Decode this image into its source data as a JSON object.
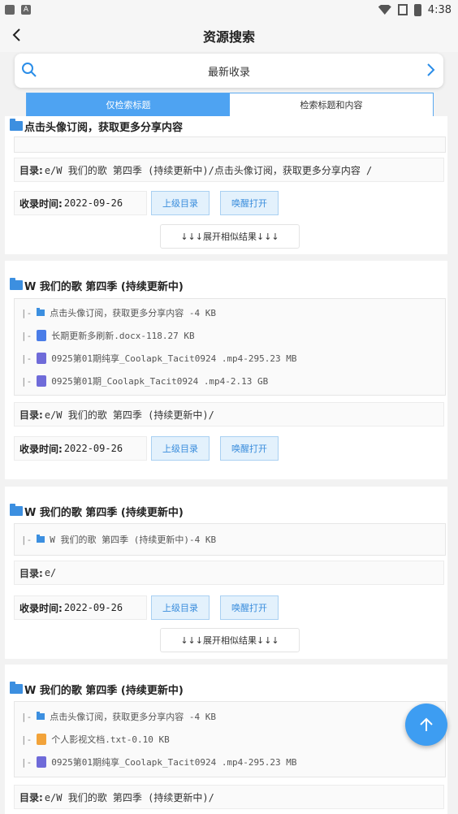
{
  "status_bar": {
    "time": "4:38",
    "left_icons": [
      "A"
    ]
  },
  "app_bar": {
    "title": "资源搜索"
  },
  "search": {
    "label": "最新收录"
  },
  "tabs": [
    {
      "label": "仅检索标题",
      "active": true
    },
    {
      "label": "检索标题和内容",
      "active": false
    }
  ],
  "results": [
    {
      "title": "点击头像订阅，获取更多分享内容",
      "files": [],
      "dir_key": "目录:",
      "dir_value": "e/W 我们的歌 第四季 (持续更新中)/点击头像订阅，获取更多分享内容 /",
      "time_key": "收录时间:",
      "time_value": "2022-09-26",
      "btn_parent": "上级目录",
      "btn_open": "唤醒打开",
      "expand": "↓↓↓展开相似结果↓↓↓"
    },
    {
      "title": "W 我们的歌 第四季 (持续更新中)",
      "files": [
        {
          "icon": "folder",
          "text": "点击头像订阅，获取更多分享内容 -4 KB"
        },
        {
          "icon": "doc",
          "text": "长期更新多刷新.docx-118.27 KB"
        },
        {
          "icon": "mp4",
          "text": "0925第01期纯享_Coolapk_Tacit0924 .mp4-295.23 MB"
        },
        {
          "icon": "mp4",
          "text": "0925第01期_Coolapk_Tacit0924 .mp4-2.13 GB"
        }
      ],
      "dir_key": "目录:",
      "dir_value": "e/W 我们的歌 第四季 (持续更新中)/",
      "time_key": "收录时间:",
      "time_value": "2022-09-26",
      "btn_parent": "上级目录",
      "btn_open": "唤醒打开"
    },
    {
      "title": "W 我们的歌 第四季 (持续更新中)",
      "files": [
        {
          "icon": "folder",
          "text": "W 我们的歌 第四季 (持续更新中)-4 KB"
        }
      ],
      "dir_key": "目录:",
      "dir_value": "e/",
      "time_key": "收录时间:",
      "time_value": "2022-09-26",
      "btn_parent": "上级目录",
      "btn_open": "唤醒打开",
      "expand": "↓↓↓展开相似结果↓↓↓"
    },
    {
      "title": "W 我们的歌 第四季 (持续更新中)",
      "files": [
        {
          "icon": "folder",
          "text": "点击头像订阅，获取更多分享内容 -4 KB"
        },
        {
          "icon": "txt",
          "text": "个人影视文档.txt-0.10 KB"
        },
        {
          "icon": "mp4",
          "text": "0925第01期纯享_Coolapk_Tacit0924 .mp4-295.23 MB"
        }
      ],
      "dir_key": "目录:",
      "dir_value": "e/W 我们的歌 第四季 (持续更新中)/"
    }
  ],
  "tree_prefix": "|-",
  "colors": {
    "accent": "#3d9df2",
    "folder": "#3c8fe0"
  }
}
